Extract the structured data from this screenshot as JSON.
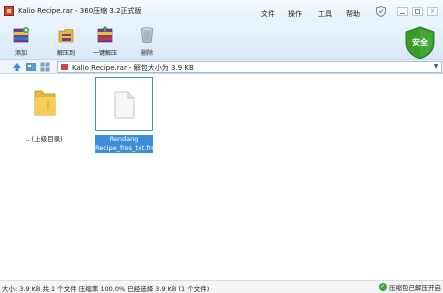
{
  "window": {
    "title": "Kalio Recipe.rar - 360压缩 3.2正式版"
  },
  "menu": {
    "file": "文件",
    "operate": "操作",
    "tools": "工具",
    "help": "帮助"
  },
  "toolbar": {
    "add": "添加",
    "extract_to": "解压到",
    "one_click_extract": "一键解压",
    "delete": "删除"
  },
  "badge": {
    "label": "安全"
  },
  "address": {
    "text": "Kalio Recipe.rar - 解包大小为 3.9 KB"
  },
  "files": [
    {
      "name": ".. (上级目录)",
      "type": "folder-up",
      "icon": "folder-icon",
      "selected": false
    },
    {
      "name": "Rendang Recipe_fres_txt.fres",
      "type": "file",
      "icon": "document-icon",
      "selected": true
    }
  ],
  "status": {
    "left": "大小: 3.9 KB 共 1 个文件 压缩率 100.0% 已经选择 3.9 KB (1 个文件)",
    "right": "压缩包已解压开启"
  },
  "colors": {
    "selection": "#3b8fd8",
    "safe_badge": "#3a9a2a"
  }
}
